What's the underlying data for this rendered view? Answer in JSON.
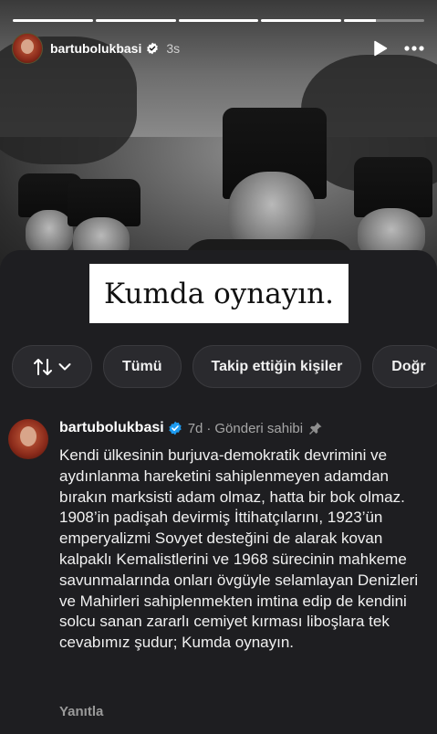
{
  "story": {
    "progress": [
      1,
      1,
      1,
      1,
      0.4
    ],
    "username": "bartubolukbasi",
    "time_ago": "3s",
    "caption": "Kumda oynayın."
  },
  "filters": {
    "all_label": "Tümü",
    "following_label": "Takip ettiğin kişiler",
    "partial_label": "Doğr"
  },
  "comment": {
    "username": "bartubolukbasi",
    "age": "7d",
    "separator": "·",
    "role": "Gönderi sahibi",
    "text": "Kendi ülkesinin burjuva-demokratik devrimini ve aydınlanma hareketini sahiplenmeyen adamdan bırakın marksisti adam olmaz, hatta bir bok olmaz. 1908’in padişah devirmiş İttihatçılarını, 1923’ün emperyalizmi Sovyet desteğini de alarak kovan kalpaklı Kemalistlerini ve 1968 sürecinin mahkeme savunmalarında onları övgüyle selamlayan Denizleri ve Mahirleri sahiplenmekten imtina edip de kendini solcu sanan zararlı cemiyet kırması liboşlara tek cevabımız şudur; Kumda oynayın.",
    "reply_label": "Yanıtla"
  },
  "colors": {
    "verified": "#1d9bf0",
    "background": "#1e1e21"
  }
}
